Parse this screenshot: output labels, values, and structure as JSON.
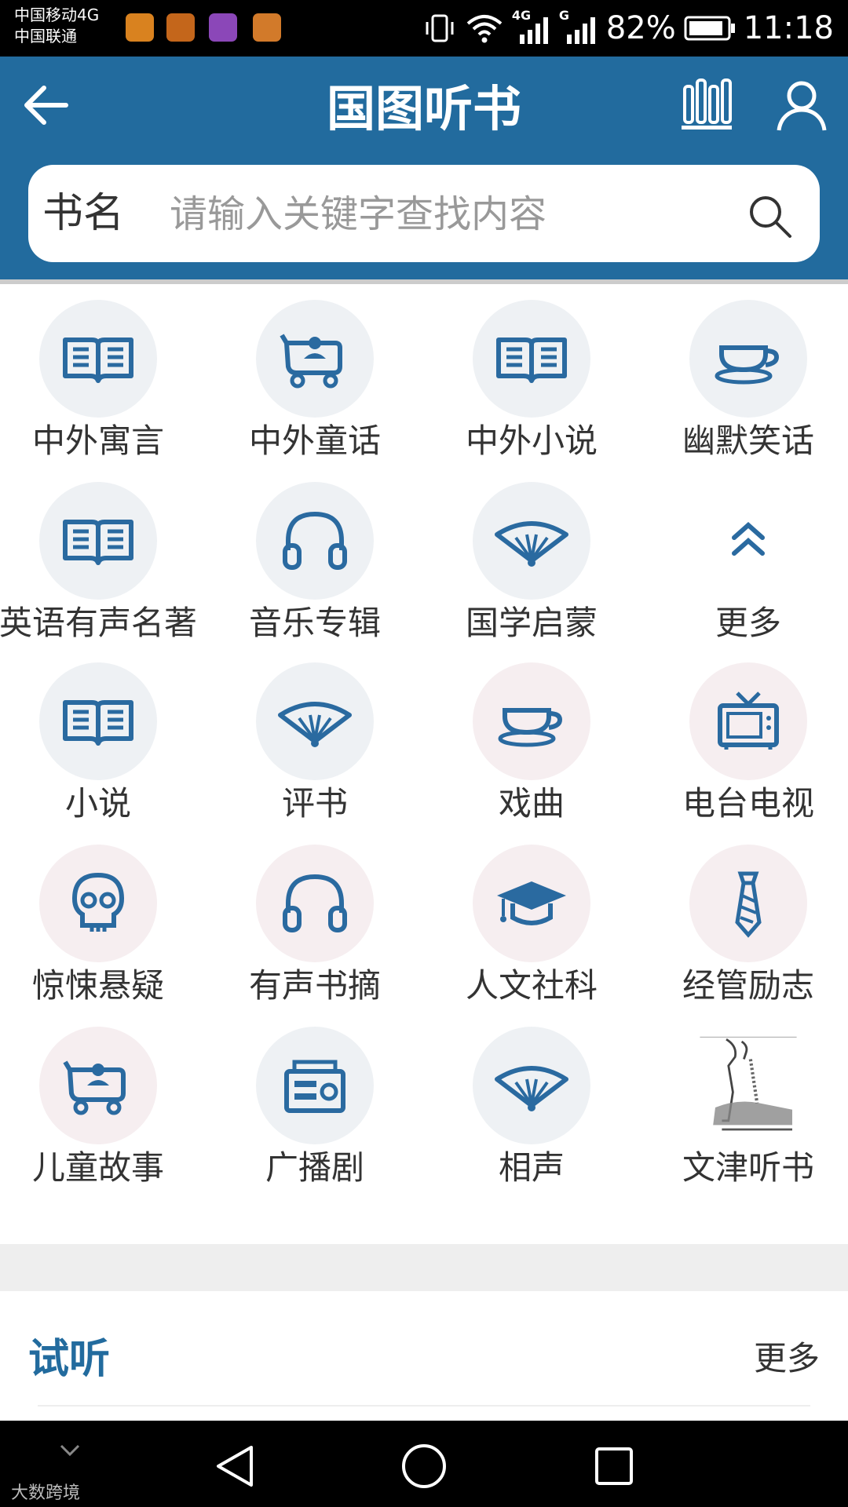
{
  "status_bar": {
    "carrier_1": "中国移动4G",
    "carrier_2": "中国联通",
    "battery_percent": "82%",
    "time": "11:18",
    "net_1": "4G",
    "net_2": "G"
  },
  "header": {
    "title": "国图听书"
  },
  "search": {
    "category": "书名",
    "placeholder": "请输入关键字查找内容"
  },
  "categories": [
    {
      "label": "中外寓言",
      "icon": "book-icon"
    },
    {
      "label": "中外童话",
      "icon": "stroller-icon"
    },
    {
      "label": "中外小说",
      "icon": "book-icon"
    },
    {
      "label": "幽默笑话",
      "icon": "teacup-icon"
    },
    {
      "label": "英语有声名著",
      "icon": "book-icon"
    },
    {
      "label": "音乐专辑",
      "icon": "headphones-icon"
    },
    {
      "label": "国学启蒙",
      "icon": "fan-icon"
    },
    {
      "label": "更多",
      "icon": "chevron-up-icon"
    },
    {
      "label": "小说",
      "icon": "book-icon"
    },
    {
      "label": "评书",
      "icon": "fan-icon"
    },
    {
      "label": "戏曲",
      "icon": "teacup-icon"
    },
    {
      "label": "电台电视",
      "icon": "tv-icon"
    },
    {
      "label": "惊悚悬疑",
      "icon": "skull-icon"
    },
    {
      "label": "有声书摘",
      "icon": "headphones-icon"
    },
    {
      "label": "人文社科",
      "icon": "graduation-cap-icon"
    },
    {
      "label": "经管励志",
      "icon": "tie-icon"
    },
    {
      "label": "儿童故事",
      "icon": "stroller-icon"
    },
    {
      "label": "广播剧",
      "icon": "radio-icon"
    },
    {
      "label": "相声",
      "icon": "fan-icon"
    },
    {
      "label": "文津听书",
      "icon": "illustration-image"
    }
  ],
  "section": {
    "title": "试听",
    "more": "更多"
  },
  "watermark": "大数跨境",
  "colors": {
    "brand": "#226b9e",
    "icon_circle": "#eef1f4",
    "icon_stroke": "#2a6aa0"
  }
}
